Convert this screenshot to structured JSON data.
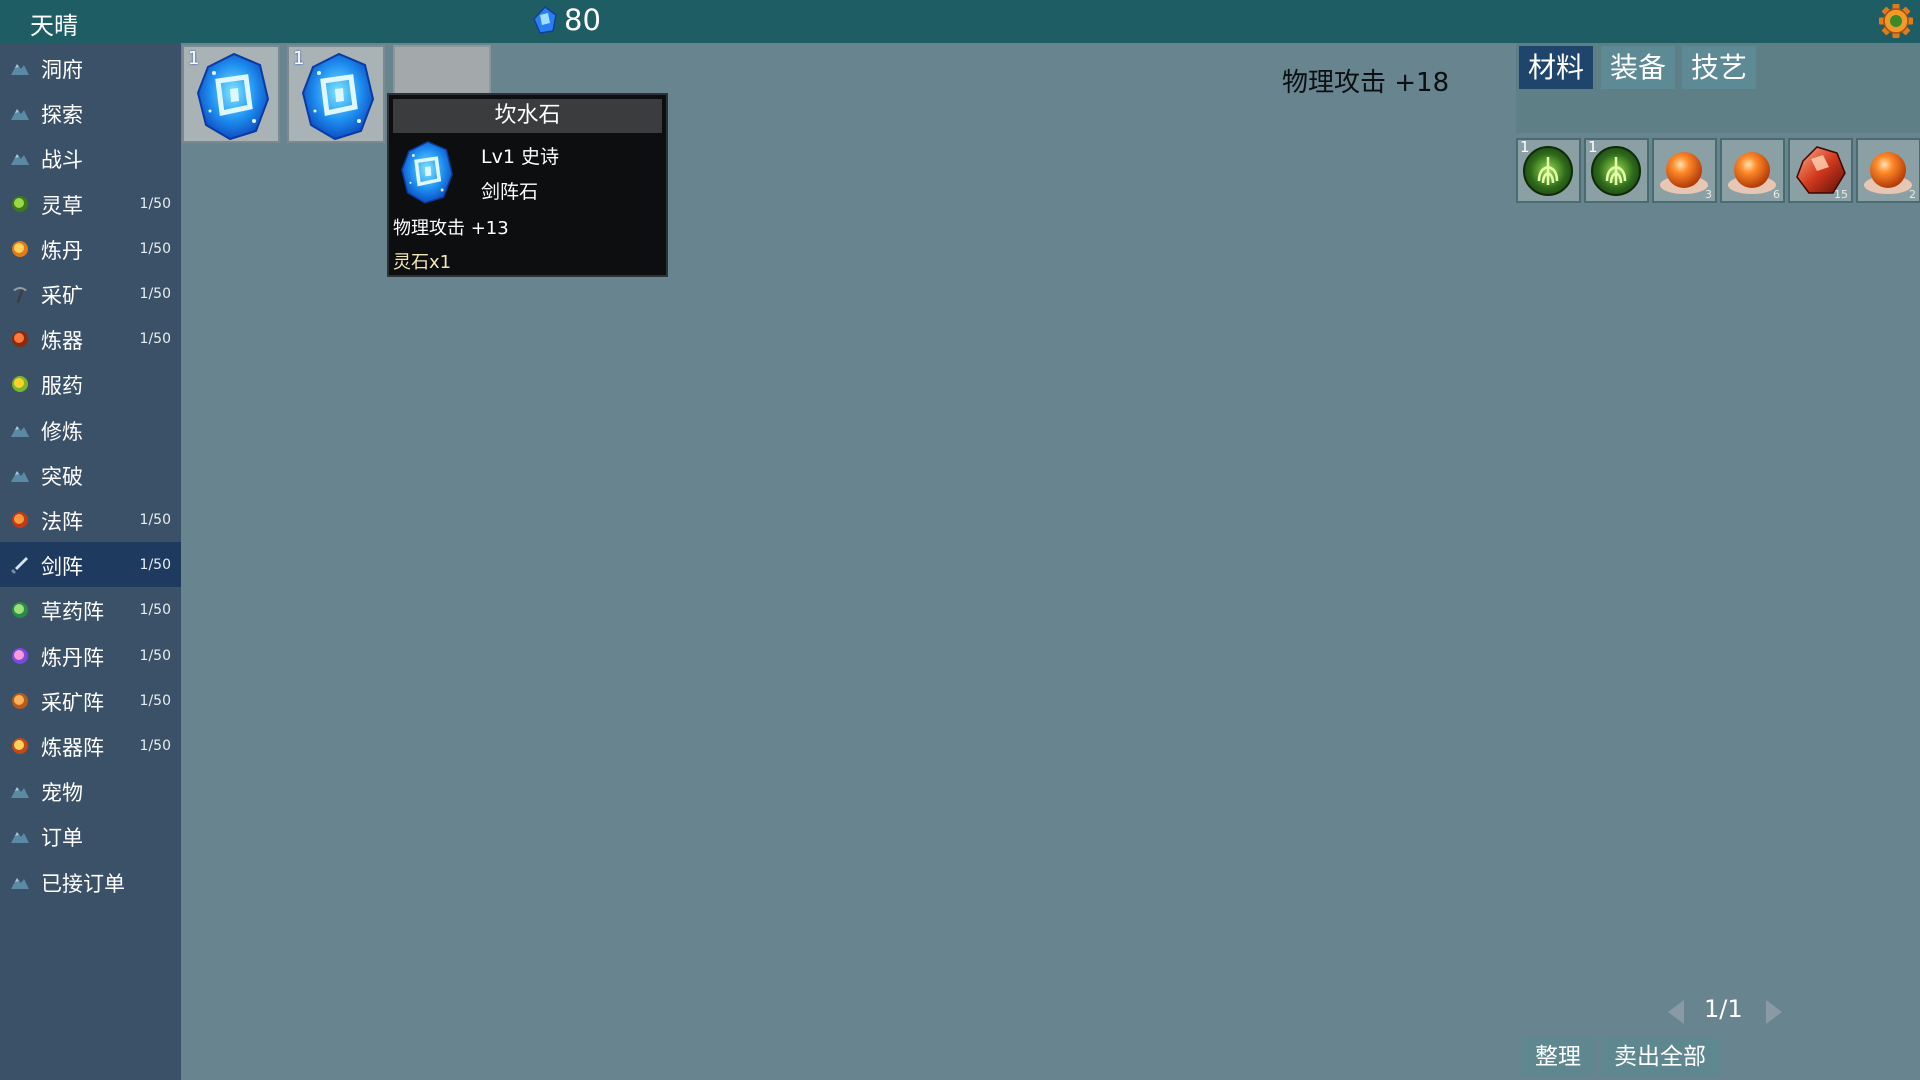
{
  "topbar": {
    "weather": "天晴",
    "currency_icon": "spirit-gem-icon",
    "currency_amount": "80",
    "settings_icon": "gear-icon"
  },
  "sidebar": {
    "items": [
      {
        "label": "洞府",
        "count": "",
        "icon": "mountain-icon"
      },
      {
        "label": "探索",
        "count": "",
        "icon": "mountain-icon"
      },
      {
        "label": "战斗",
        "count": "",
        "icon": "mountain-icon"
      },
      {
        "label": "灵草",
        "count": "1/50",
        "icon": "herb-icon"
      },
      {
        "label": "炼丹",
        "count": "1/50",
        "icon": "pill-icon"
      },
      {
        "label": "采矿",
        "count": "1/50",
        "icon": "pickaxe-icon"
      },
      {
        "label": "炼器",
        "count": "1/50",
        "icon": "forge-icon"
      },
      {
        "label": "服药",
        "count": "",
        "icon": "fruit-icon"
      },
      {
        "label": "修炼",
        "count": "",
        "icon": "mountain-icon"
      },
      {
        "label": "突破",
        "count": "",
        "icon": "mountain-icon"
      },
      {
        "label": "法阵",
        "count": "1/50",
        "icon": "magic-array-icon"
      },
      {
        "label": "剑阵",
        "count": "1/50",
        "icon": "sword-icon"
      },
      {
        "label": "草药阵",
        "count": "1/50",
        "icon": "herb-array-icon"
      },
      {
        "label": "炼丹阵",
        "count": "1/50",
        "icon": "alchemy-array-icon"
      },
      {
        "label": "采矿阵",
        "count": "1/50",
        "icon": "mining-array-icon"
      },
      {
        "label": "炼器阵",
        "count": "1/50",
        "icon": "forging-array-icon"
      },
      {
        "label": "宠物",
        "count": "",
        "icon": "mountain-icon"
      },
      {
        "label": "订单",
        "count": "",
        "icon": "mountain-icon"
      },
      {
        "label": "已接订单",
        "count": "",
        "icon": "mountain-icon"
      }
    ],
    "active_label": "剑阵"
  },
  "slots": [
    {
      "qty": "1",
      "item": "kanshui-stone-icon"
    },
    {
      "qty": "1",
      "item": "kanshui-stone-icon"
    },
    {
      "qty": "",
      "item": ""
    }
  ],
  "tooltip": {
    "title": "坎水石",
    "rarity": "Lv1 史诗",
    "type": "剑阵石",
    "stat": "物理攻击 +13",
    "price": "灵石x1",
    "icon": "kanshui-stone-icon"
  },
  "total_stat": "物理攻击 +18",
  "inventory": {
    "tabs": [
      {
        "label": "材料",
        "active": true
      },
      {
        "label": "装备",
        "active": false
      },
      {
        "label": "技艺",
        "active": false
      }
    ],
    "items": [
      {
        "qty_tl": "1",
        "qty_br": "",
        "icon": "green-herb-seal-icon"
      },
      {
        "qty_tl": "1",
        "qty_br": "",
        "icon": "green-herb-seal-icon"
      },
      {
        "qty_tl": "",
        "qty_br": "3",
        "icon": "orange-orb-icon"
      },
      {
        "qty_tl": "",
        "qty_br": "6",
        "icon": "orange-orb-icon"
      },
      {
        "qty_tl": "",
        "qty_br": "15",
        "icon": "red-crystal-icon"
      },
      {
        "qty_tl": "",
        "qty_br": "2",
        "icon": "orange-orb-icon"
      }
    ],
    "page": "1/1",
    "sort_label": "整理",
    "sell_all_label": "卖出全部"
  },
  "colors": {
    "topbar": "#1f5d64",
    "sidebar": "#3b5168",
    "sidebar_active": "#1e3a5e",
    "main_bg": "#68848f",
    "tab_active": "#1f456c",
    "tooltip_bg": "#0c0e10",
    "price_text": "#f1e6b8"
  }
}
